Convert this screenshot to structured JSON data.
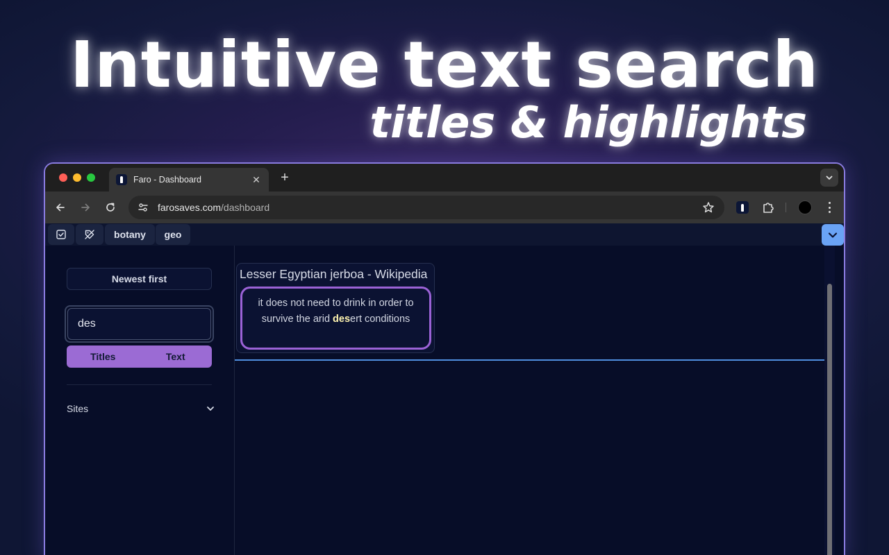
{
  "hero": {
    "headline": "Intuitive text search",
    "subheadline": "titles & highlights"
  },
  "browser": {
    "tab_title": "Faro - Dashboard",
    "tab_close": "✕",
    "new_tab": "+",
    "url_domain": "farosaves.com",
    "url_path": "/dashboard"
  },
  "app": {
    "tags": [
      "botany",
      "geo"
    ],
    "sort_label": "Newest first",
    "search": {
      "value": "des",
      "placeholder": ""
    },
    "modes": [
      "Titles",
      "Text"
    ],
    "active_mode": "Titles",
    "sites_label": "Sites",
    "results": [
      {
        "title": "Lesser Egyptian jerboa - Wikipedia",
        "highlight_before": "it does not need to drink in order to survive the arid ",
        "highlight_match": "des",
        "highlight_after": "ert conditions"
      }
    ]
  },
  "colors": {
    "accent_purple": "#9b6bd4",
    "highlight_border": "#9b62d6",
    "accent_blue": "#6aa3f5",
    "match_text": "#fff4b0",
    "page_bg": "#070d28"
  }
}
